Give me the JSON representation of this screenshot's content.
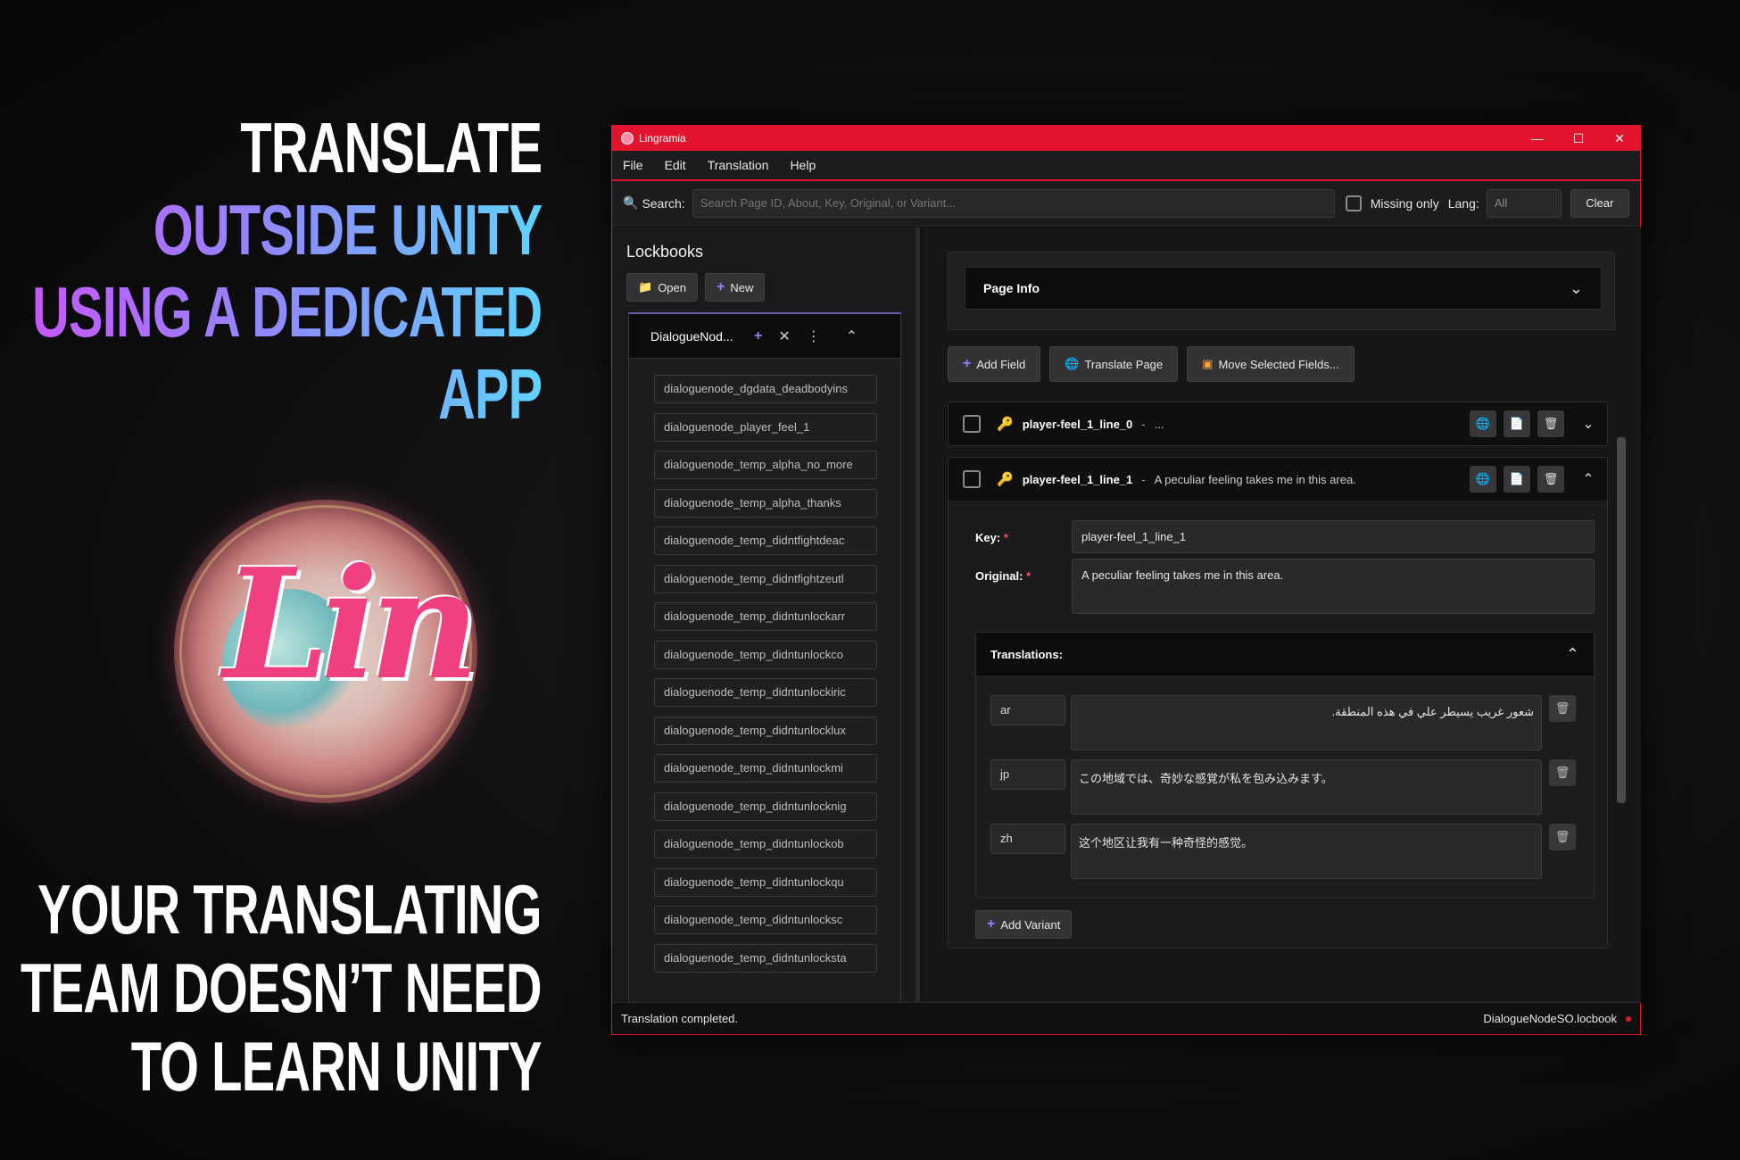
{
  "promo": {
    "headline": [
      "TRANSLATE",
      "OUTSIDE UNITY",
      "USING A DEDICATED",
      "APP"
    ],
    "subline": [
      "YOUR TRANSLATING",
      "TEAM DOESN’T NEED",
      "TO LEARN UNITY"
    ],
    "logo_text": "Lin"
  },
  "window": {
    "title": "Lingramia",
    "controls": {
      "minimize": "—",
      "maximize": "☐",
      "close": "✕"
    }
  },
  "menu": [
    "File",
    "Edit",
    "Translation",
    "Help"
  ],
  "search": {
    "label": "Search:",
    "placeholder": "Search Page ID, About, Key, Original, or Variant...",
    "missing_only_label": "Missing only",
    "lang_label": "Lang:",
    "lang_value": "All",
    "clear_label": "Clear"
  },
  "sidebar": {
    "title": "Lockbooks",
    "open_label": "Open",
    "new_label": "New",
    "lockbook": {
      "name": "DialogueNod...",
      "pages": [
        "dialoguenode_dgdata_deadbodyins",
        "dialoguenode_player_feel_1",
        "dialoguenode_temp_alpha_no_more",
        "dialoguenode_temp_alpha_thanks",
        "dialoguenode_temp_didntfightdeac",
        "dialoguenode_temp_didntfightzeutl",
        "dialoguenode_temp_didntunlockarr",
        "dialoguenode_temp_didntunlockco",
        "dialoguenode_temp_didntunlockiric",
        "dialoguenode_temp_didntunlocklux",
        "dialoguenode_temp_didntunlockmi",
        "dialoguenode_temp_didntunlocknig",
        "dialoguenode_temp_didntunlockob",
        "dialoguenode_temp_didntunlockqu",
        "dialoguenode_temp_didntunlocksc",
        "dialoguenode_temp_didntunlocksta"
      ]
    }
  },
  "main": {
    "page_info_label": "Page Info",
    "actions": {
      "add_field": "Add Field",
      "translate_page": "Translate Page",
      "move_selected": "Move Selected Fields..."
    },
    "fields": [
      {
        "key": "player-feel_1_line_0",
        "summary": "..."
      },
      {
        "key": "player-feel_1_line_1",
        "summary": "A peculiar feeling takes me in this area."
      }
    ],
    "editor": {
      "key_label": "Key:",
      "key_value": "player-feel_1_line_1",
      "original_label": "Original:",
      "original_value": "A peculiar feeling takes me in this area.",
      "translations_label": "Translations:",
      "translations": [
        {
          "lang": "ar",
          "text": "شعور غريب يسيطر علي في هذه المنطقة."
        },
        {
          "lang": "jp",
          "text": "この地域では、奇妙な感覚が私を包み込みます。"
        },
        {
          "lang": "zh",
          "text": "这个地区让我有一种奇怪的感觉。"
        }
      ],
      "add_variant_label": "Add Variant"
    }
  },
  "status": {
    "message": "Translation completed.",
    "file": "DialogueNodeSO.locbook"
  },
  "colors": {
    "accent": "#e3142e",
    "purple_icon": "#9a7bff",
    "key_icon": "#f5b83d"
  }
}
